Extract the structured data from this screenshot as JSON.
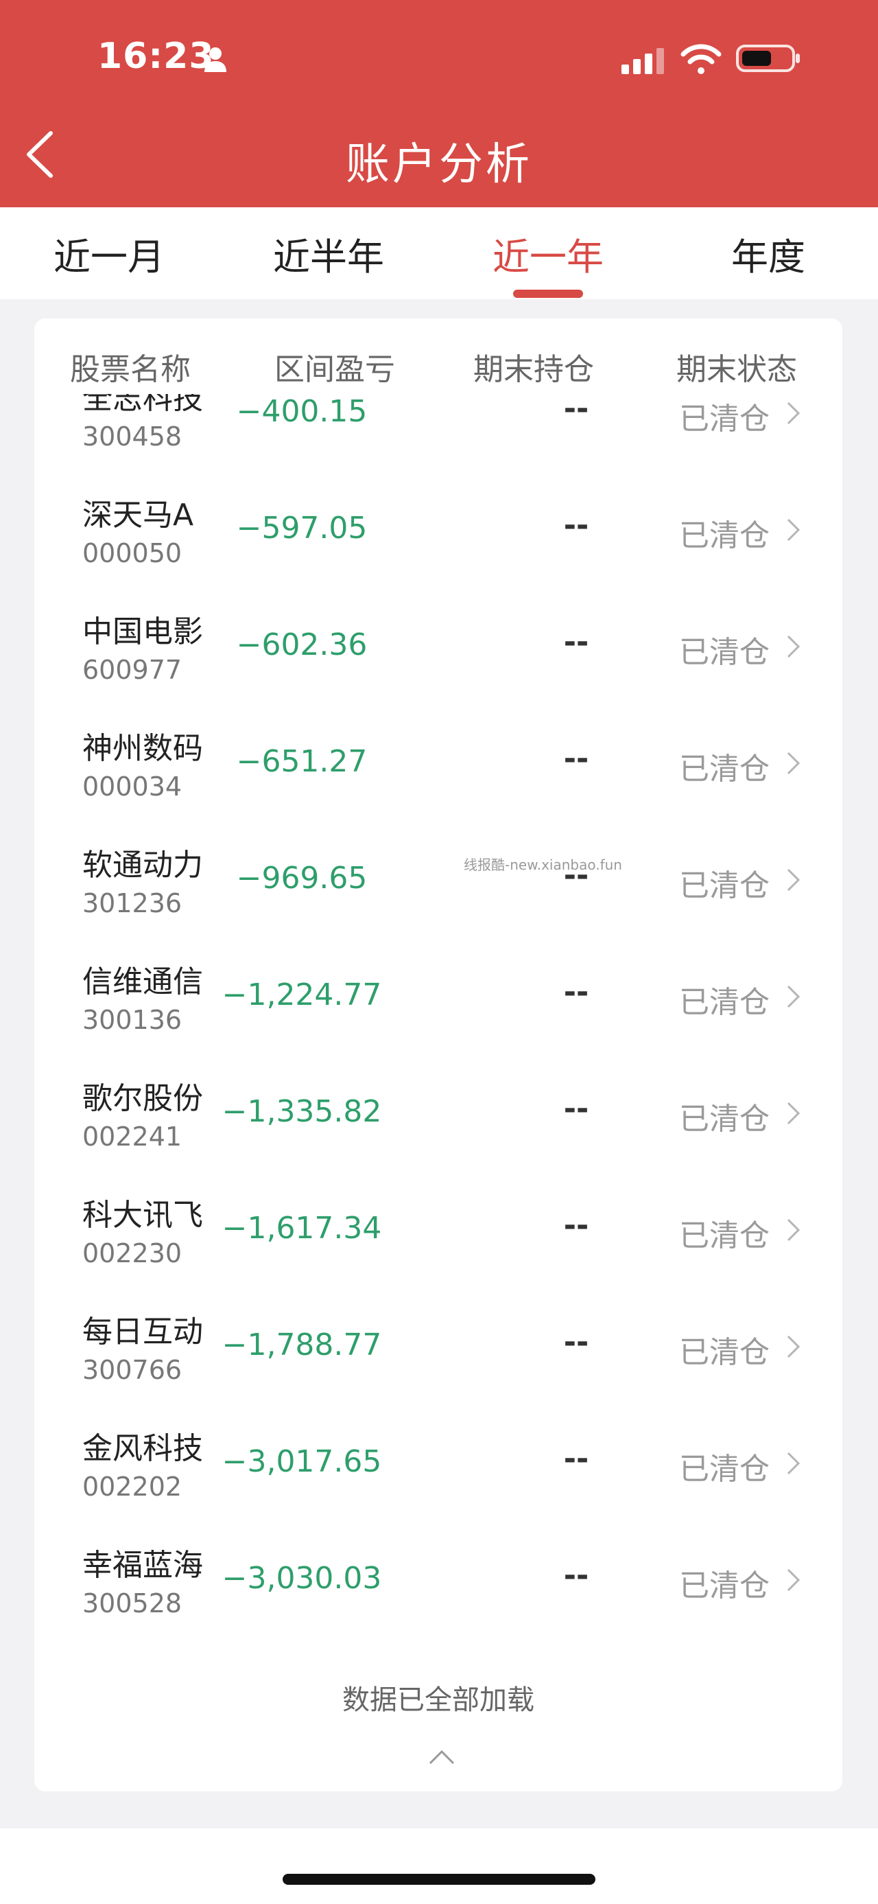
{
  "status_bar": {
    "time": "16:23"
  },
  "header": {
    "title": "账户分析"
  },
  "tabs": [
    {
      "label": "近一月",
      "active": false
    },
    {
      "label": "近半年",
      "active": false
    },
    {
      "label": "近一年",
      "active": true
    },
    {
      "label": "年度",
      "active": false
    }
  ],
  "table": {
    "columns": [
      "股票名称",
      "区间盈亏",
      "期末持仓",
      "期末状态"
    ],
    "rows": [
      {
        "name": "全志科技",
        "code": "300458",
        "pnl": "−400.15",
        "holding": "--",
        "status": "已清仓"
      },
      {
        "name": "深天马A",
        "code": "000050",
        "pnl": "−597.05",
        "holding": "--",
        "status": "已清仓"
      },
      {
        "name": "中国电影",
        "code": "600977",
        "pnl": "−602.36",
        "holding": "--",
        "status": "已清仓"
      },
      {
        "name": "神州数码",
        "code": "000034",
        "pnl": "−651.27",
        "holding": "--",
        "status": "已清仓"
      },
      {
        "name": "软通动力",
        "code": "301236",
        "pnl": "−969.65",
        "holding": "--",
        "status": "已清仓"
      },
      {
        "name": "信维通信",
        "code": "300136",
        "pnl": "−1,224.77",
        "holding": "--",
        "status": "已清仓"
      },
      {
        "name": "歌尔股份",
        "code": "002241",
        "pnl": "−1,335.82",
        "holding": "--",
        "status": "已清仓"
      },
      {
        "name": "科大讯飞",
        "code": "002230",
        "pnl": "−1,617.34",
        "holding": "--",
        "status": "已清仓"
      },
      {
        "name": "每日互动",
        "code": "300766",
        "pnl": "−1,788.77",
        "holding": "--",
        "status": "已清仓"
      },
      {
        "name": "金风科技",
        "code": "002202",
        "pnl": "−3,017.65",
        "holding": "--",
        "status": "已清仓"
      },
      {
        "name": "幸福蓝海",
        "code": "300528",
        "pnl": "−3,030.03",
        "holding": "--",
        "status": "已清仓"
      }
    ],
    "footer": "数据已全部加载"
  },
  "watermark": "线报酷-new.xianbao.fun",
  "colors": {
    "header_bg": "#d84a45",
    "accent": "#d84a45",
    "loss": "#2e9e6b",
    "muted": "#9a9a9a"
  }
}
